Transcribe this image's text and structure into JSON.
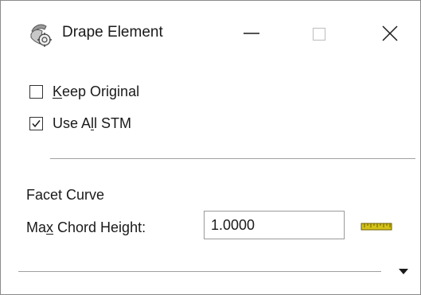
{
  "window": {
    "title": "Drape Element",
    "icon": "drape-element-icon",
    "controls": {
      "minimize": "minimize-icon",
      "maximize": "maximize-icon",
      "close": "close-icon"
    }
  },
  "options": {
    "keep_original": {
      "prefix": "",
      "accel": "K",
      "suffix": "eep Original",
      "checked": false
    },
    "use_all_stm": {
      "prefix": "Use A",
      "accel": "l",
      "suffix": "l STM",
      "checked": true
    }
  },
  "facet_curve": {
    "section_label": "Facet Curve",
    "max_chord_height": {
      "label_prefix": "Ma",
      "label_accel": "x",
      "label_suffix": " Chord Height:",
      "value": "1.0000"
    },
    "ruler_icon": "ruler-icon"
  },
  "footer": {
    "expand_icon": "triangle-down-icon"
  },
  "colors": {
    "ruler_fill": "#d4c21a",
    "ruler_stroke": "#6b5d00",
    "divider": "#a0a0a0"
  }
}
